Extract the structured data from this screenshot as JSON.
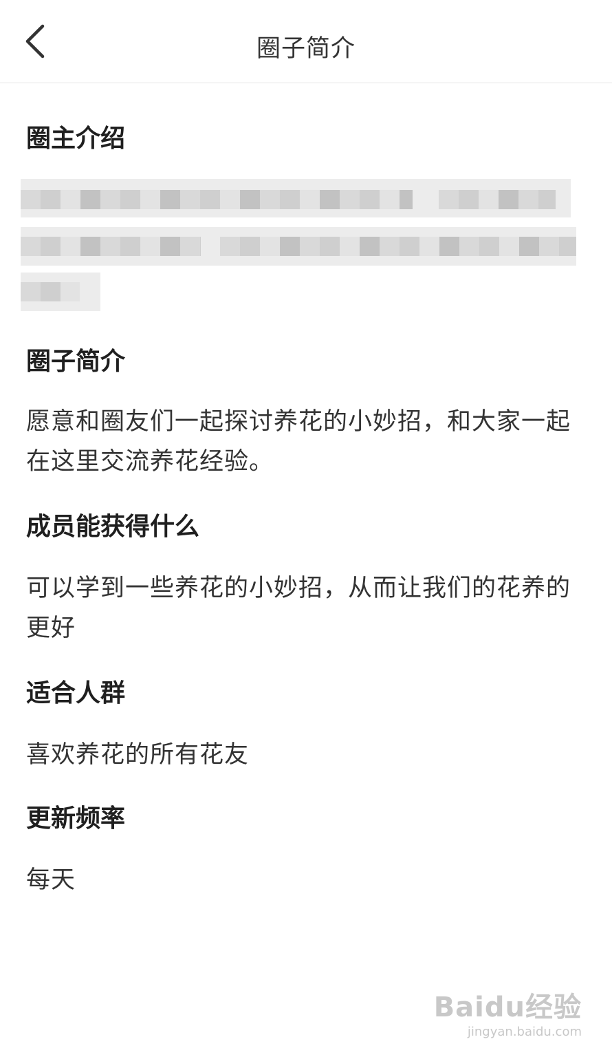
{
  "header": {
    "title": "圈子简介"
  },
  "sections": [
    {
      "heading": "圈主介绍",
      "body": ""
    },
    {
      "heading": "圈子简介",
      "body": "愿意和圈友们一起探讨养花的小妙招，和大家一起在这里交流养花经验。"
    },
    {
      "heading": "成员能获得什么",
      "body": "可以学到一些养花的小妙招，从而让我们的花养的更好"
    },
    {
      "heading": "适合人群",
      "body": "喜欢养花的所有花友"
    },
    {
      "heading": "更新频率",
      "body": "每天"
    }
  ],
  "icons": {
    "back": "chevron-left-icon"
  },
  "colors": {
    "text": "#222222",
    "divider": "#e4e4e4",
    "redacted": "#d0d0d0"
  },
  "watermark": {
    "logo": "Baidu经验",
    "url": "jingyan.baidu.com"
  }
}
